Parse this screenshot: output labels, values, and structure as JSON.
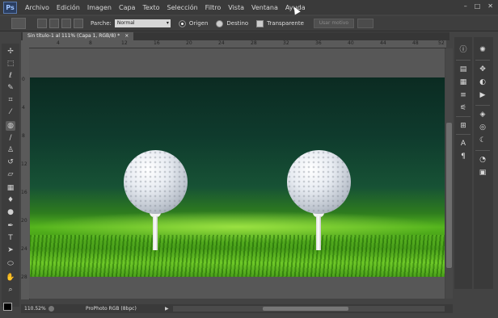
{
  "app": {
    "logo": "Ps",
    "menu": [
      "Archivo",
      "Edición",
      "Imagen",
      "Capa",
      "Texto",
      "Selección",
      "Filtro",
      "Vista",
      "Ventana",
      "Ayuda"
    ],
    "window_controls": [
      "–",
      "□",
      "✕"
    ]
  },
  "options": {
    "parche_label": "Parche:",
    "parche_value": "Normal",
    "origen_label": "Origen",
    "destino_label": "Destino",
    "transparente_label": "Transparente",
    "usar_motivo_label": "Usar motivo"
  },
  "document": {
    "tab_title": "Sin título-1 al 111% (Capa 1, RGB/8) *",
    "tab_close": "×"
  },
  "rulers": {
    "top": [
      "4",
      "8",
      "12",
      "16",
      "20",
      "24",
      "28",
      "32",
      "36",
      "40",
      "44",
      "48",
      "52"
    ],
    "left": [
      "0",
      "4",
      "8",
      "12",
      "16",
      "20",
      "24",
      "28",
      "32"
    ]
  },
  "status": {
    "zoom": "110.52%",
    "doc_info": "ProPhoto RGB (8bpc)",
    "arrow": "▶"
  },
  "tools": [
    "move-icon",
    "marquee-icon",
    "lasso-icon",
    "quick-select-icon",
    "crop-icon",
    "eyedropper-icon",
    "patch-icon",
    "brush-icon",
    "clone-stamp-icon",
    "history-brush-icon",
    "eraser-icon",
    "gradient-icon",
    "blur-icon",
    "dodge-icon",
    "pen-icon",
    "type-icon",
    "path-select-icon",
    "shape-icon",
    "hand-icon",
    "zoom-icon"
  ],
  "panel_icons_left": [
    "info-icon",
    "histogram-icon",
    "swatches-icon",
    "actions-icon",
    "adjust-icon",
    "layer-comps-icon",
    "character-icon",
    "paragraph-icon"
  ],
  "panel_icons_right": [
    "brush-preset-icon",
    "navigator-icon",
    "play-icon",
    "layers-icon",
    "channels-icon",
    "paths-icon",
    "properties-icon",
    "options-icon"
  ]
}
